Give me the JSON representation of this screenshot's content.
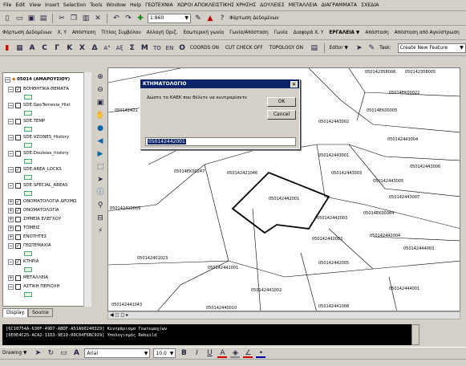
{
  "menu": [
    "File",
    "Edit",
    "View",
    "Insert",
    "Selection",
    "Tools",
    "Window",
    "Help",
    "ΓΕΩΤΕΧΝΙΑ",
    "ΧΩΡΟΙ ΑΠΟΚΛΕΙΣΤΙΚΗΣ ΧΡΗΣΗΣ",
    "ΔΟΥΛΕΙΕΣ",
    "ΜΕΤΑΛΛΕΙΑ",
    "ΔΙΑΓΡΑΜΜΑΤΑ",
    "ΣΧΕΔΙΑ"
  ],
  "standard_toolbar": {
    "scale_value": "1:860",
    "data_label": "Φόρτωση Δεδομένων"
  },
  "custom_toolbar": {
    "items": [
      "Φόρτωση Δεδομένων",
      "Χ, Υ",
      "Απόσταση",
      "Τίτλος Συμβόλου",
      "Αλλαγή Οριζ.",
      "Εσωτερική γωνία",
      "Γωνία/Απόσταση",
      "Γωνία",
      "Διαφορά Χ, Υ"
    ],
    "ergaleia_label": "ΕΡΓΑΛΕΙΑ ▼",
    "apostasi_label": "Απόσταση",
    "apostasi2_label": "Απόσταση από Αγκύστρωση"
  },
  "cogo_toolbar": {
    "glyphs": [
      "A",
      "C",
      "Γ",
      "K",
      "X",
      "Δ",
      "A°",
      "Aξ",
      "Σ",
      "M",
      "TO",
      "EN",
      "O"
    ],
    "coords_label": "COORDS ON",
    "cutcheck_label": "CUT CHECK OFF",
    "topology_label": "TOPOLOGY ON",
    "editor_label": "Editor ▼",
    "task_label": "Task:",
    "task_value": "Create New Feature"
  },
  "toc": {
    "root": "05014 (ΑΜΑΡΟΥΣΙΟΥ)",
    "rows": [
      {
        "label": "ΒΟΗΘΗΤΙΚΑ ΘΕΜΑΤΑ",
        "expanded": true,
        "checked": true
      },
      {
        "label": "SDE.GeoTemesia_Hist",
        "expanded": true,
        "checked": false
      },
      {
        "label": "SDE.TEMP",
        "expanded": true,
        "checked": false
      },
      {
        "label": "SDE.VZONES_History",
        "expanded": true,
        "checked": false
      },
      {
        "label": "SDE.Doulsies_history",
        "expanded": true,
        "checked": false
      },
      {
        "label": "SDE.AREA_LOCKS",
        "expanded": true,
        "checked": true
      },
      {
        "label": "SDE.SPECIAL_AREAS",
        "expanded": true,
        "checked": false
      },
      {
        "label": "ΟΝΟΜΑΤΟΛΟΓΙΑ ΔΡΟΜΩ",
        "expanded": false,
        "checked": true
      },
      {
        "label": "ΟΝΟΜΑΤΟΛΟΓΙΑ",
        "expanded": false,
        "checked": true
      },
      {
        "label": "ΣΗΜΕΙΑ ΕΛΕΓΧΟΥ",
        "expanded": false,
        "checked": false
      },
      {
        "label": "ΤΟΜΕΙΣ",
        "expanded": false,
        "checked": false
      },
      {
        "label": "ΕΝΟΤΗΤΕΣ",
        "expanded": false,
        "checked": false
      },
      {
        "label": "ΓΕΩΤΕΜΑΧΙΑ",
        "expanded": true,
        "checked": true
      },
      {
        "label": "ΚΤΗΡΙΑ",
        "expanded": true,
        "checked": true
      },
      {
        "label": "ΜΕΤΑΛΛΕΙΑ",
        "expanded": false,
        "checked": false
      },
      {
        "label": "ΑΣΤΙΚΗ ΠΕΡΙΟΧΗ",
        "expanded": true,
        "checked": false
      }
    ],
    "tabs": [
      "Display",
      "Source"
    ]
  },
  "map": {
    "labels": [
      "050142358008",
      "050142358005",
      "050142421",
      "05014EK00022",
      "050142443002",
      "05014EK00005",
      "050142443004",
      "050142443001",
      "05014EK00247",
      "050142421046",
      "050142443003",
      "050142443006",
      "050142443005",
      "050142420009",
      "050142442001",
      "050142443007",
      "050142442003",
      "05014EK00084",
      "050142442002",
      "050142442004",
      "050142444003",
      "050142401023",
      "050142441001",
      "050142442005",
      "050142444001",
      "050142441002",
      "050142441043",
      "050142440010",
      "050142441008"
    ],
    "scroll_label": "◀ ◻ ◻ ▸"
  },
  "dialog": {
    "title": "ΚΤΗΜΑΤΟΛΟΓΙΟ",
    "prompt": "Δώστε το ΚΑΕΚ που θέλετε να κεντραρίσετε",
    "ok_label": "OK",
    "cancel_label": "Cancel",
    "input_value": "050142442001"
  },
  "command_window": {
    "line1": "[6C10754A-630F-49D7-ABDF-A51A60240329]   Κεντράρισμα Γεωτεμαχίων",
    "line2": "[0E0E4C25-ACA2-11D3-9E19-00C04F6BC929]   Υπολογισμός Rebuild"
  },
  "drawing_toolbar": {
    "drawing_label": "Drawing ▼",
    "font_name": "Arial",
    "font_size": "10.0",
    "bold_label": "B",
    "italic_label": "I",
    "underline_label": "U"
  }
}
